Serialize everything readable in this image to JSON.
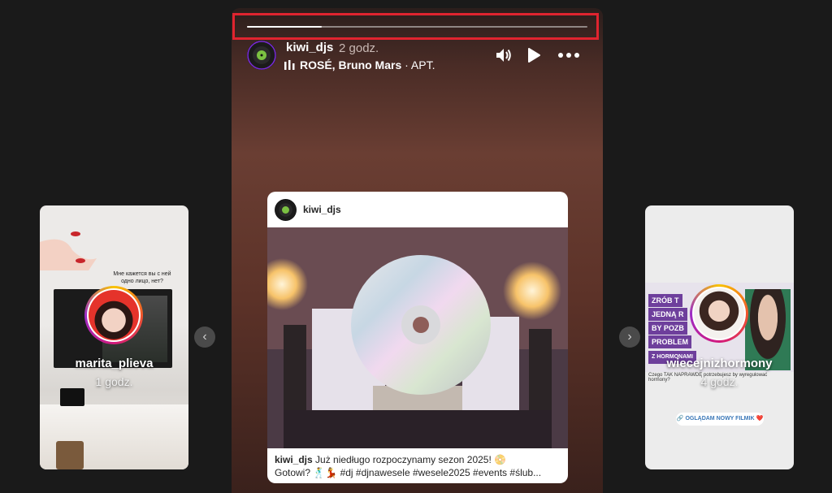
{
  "left_story": {
    "username": "marita_plieva",
    "time": "1 godz.",
    "overlay_text": "Мне кажется вы с ней одно лицо, нет?"
  },
  "right_story": {
    "username": "wiecejnizhormony",
    "time": "4 godz.",
    "banner_lines": [
      "ZRÓB T",
      "JEDNĄ R",
      "BY POZB",
      "PROBLEM",
      "Z HORMONAMI"
    ],
    "post_text": "Czego TAK NAPRAWDĘ potrzebujesz by wyregulować hormony?",
    "link_label": "🔗 OGLĄDAM NOWY FILMIK ❤️"
  },
  "main_story": {
    "username": "kiwi_djs",
    "time": "2 godz.",
    "music_artist": "ROSÉ, Bruno Mars",
    "music_title": " · APT.",
    "progress": 0.22,
    "post": {
      "username": "kiwi_djs",
      "caption_user": "kiwi_djs",
      "caption_text": " Już niedługo rozpoczynamy sezon 2025! 📀",
      "caption_line2": "Gotowi? 🕺💃 #dj #djnawesele #wesele2025 #events #ślub..."
    }
  },
  "icons": {
    "volume": "volume-icon",
    "play": "play-icon",
    "more": "more-icon",
    "prev": "chevron-left-icon",
    "next": "chevron-right-icon"
  },
  "colors": {
    "highlight": "#e0242f",
    "ring_start": "#f9c400",
    "ring_end": "#d3197c"
  }
}
